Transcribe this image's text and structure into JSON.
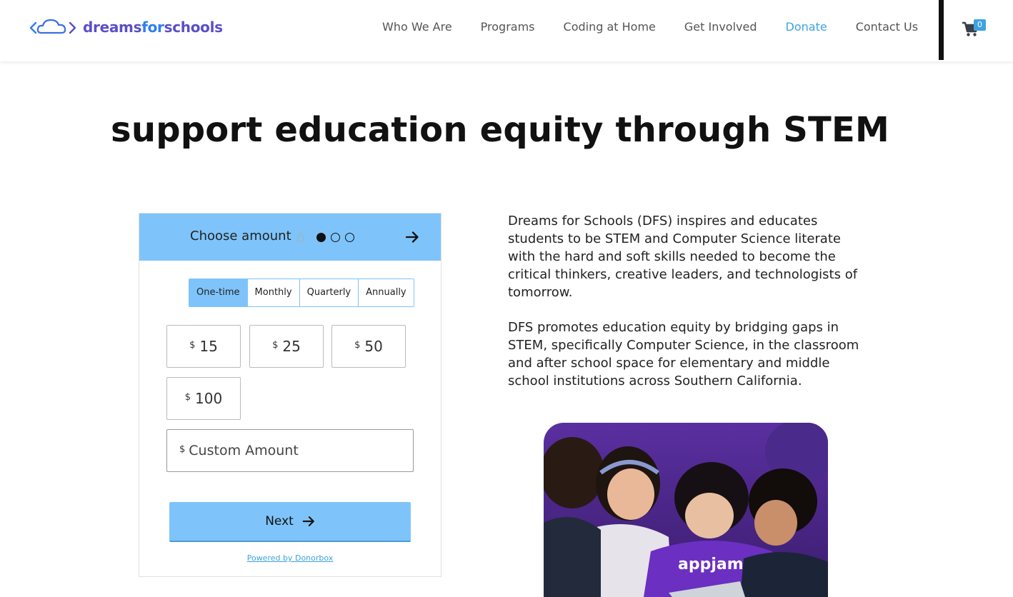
{
  "header": {
    "logo": {
      "part1": "dreams",
      "part2": "for",
      "part3": "schools"
    },
    "nav": [
      {
        "label": "Who We Are"
      },
      {
        "label": "Programs"
      },
      {
        "label": "Coding at Home"
      },
      {
        "label": "Get Involved"
      },
      {
        "label": "Donate",
        "active": true
      },
      {
        "label": "Contact Us"
      }
    ],
    "cart_count": "0",
    "colors": {
      "accent": "#3ea3e0",
      "logo_purple": "#5a4fc8",
      "logo_blue": "#2f7ff0"
    }
  },
  "hero": {
    "title": "support education equity through STEM"
  },
  "widget": {
    "title": "Choose amount",
    "step_indicator": {
      "current": 1,
      "total": 3
    },
    "frequencies": [
      "One-time",
      "Monthly",
      "Quarterly",
      "Annually"
    ],
    "selected_frequency": "One-time",
    "currency_symbol": "$",
    "amounts": [
      "15",
      "25",
      "50",
      "100"
    ],
    "custom_placeholder": "Custom Amount",
    "next_label": "Next",
    "powered_by": "Powered by Donorbox",
    "colors": {
      "primary": "#7ec4fb"
    }
  },
  "content": {
    "paragraph1": "Dreams for Schools (DFS) inspires and educates students to be STEM and Computer Science literate with the hard and soft skills needed to become the critical thinkers, creative leaders, and technologists of tomorrow.",
    "paragraph2": "DFS promotes education equity by bridging gaps in STEM, specifically Computer Science, in the classroom and after school space for elementary and middle school institutions across Southern California."
  },
  "photo": {
    "shirt_text": "appjam"
  }
}
